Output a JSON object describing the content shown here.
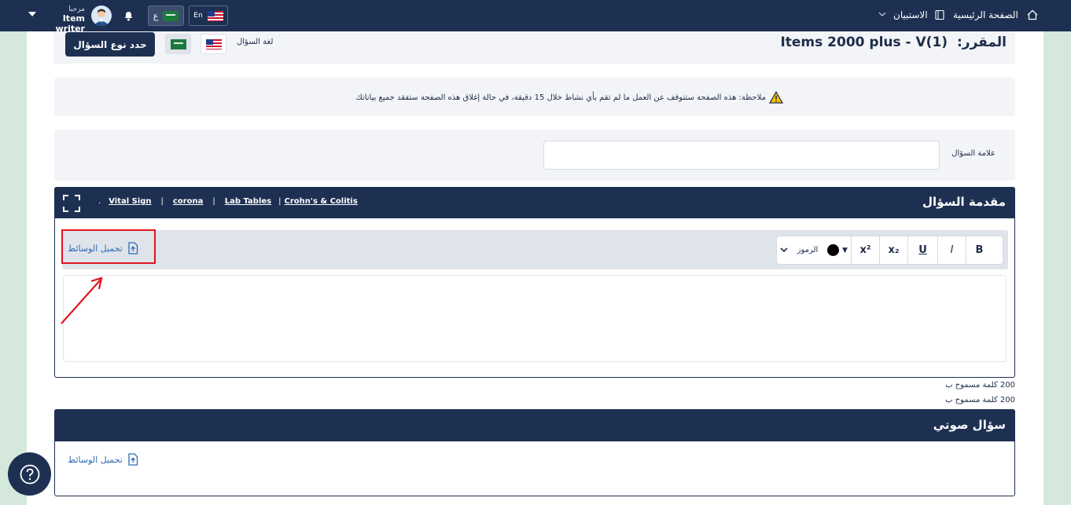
{
  "nav": {
    "home_label": "الصفحة الرئيسية",
    "survey_label": "الاستبيان",
    "greeting": "مرحبا",
    "user_name": "Item writer",
    "lang_en_label": "En",
    "lang_ar_label": "ع"
  },
  "course": {
    "label": "المقرر:",
    "name": "Items 2000 plus - V(1)",
    "question_language_label": "لغة السؤال",
    "select_type_button": "حدد نوع السؤال"
  },
  "notice": {
    "text": "ملاحظة: هذه الصفحة ستتوقف عن العمل ما لم تقم بأي نشاط خلال 15 دقيقة، في حالة إغلاق هذه الصفحة ستفقد جميع بياناتك"
  },
  "question_mark": {
    "label": "علامة السؤال",
    "value": ""
  },
  "intro": {
    "title": "مقدمة السؤال",
    "tags": [
      "Vital Sign",
      "corona",
      "Lab Tables",
      "Crohn's & Colitis"
    ],
    "toolbar": {
      "bold": "B",
      "italic": "I",
      "underline": "U",
      "subscript": "x₂",
      "superscript": "x²",
      "symbols_label": "الرموز"
    },
    "upload_label": "تحميل الوسائط",
    "word_limit_1": "200 كلمة مسموح ب",
    "word_limit_2": "200 كلمة مسموح ب"
  },
  "audio": {
    "title": "سؤال صوتي",
    "upload_label": "تحميل الوسائط"
  },
  "colors": {
    "navy": "#1e3052",
    "link": "#2f6db5",
    "highlight": "#e0141e"
  }
}
